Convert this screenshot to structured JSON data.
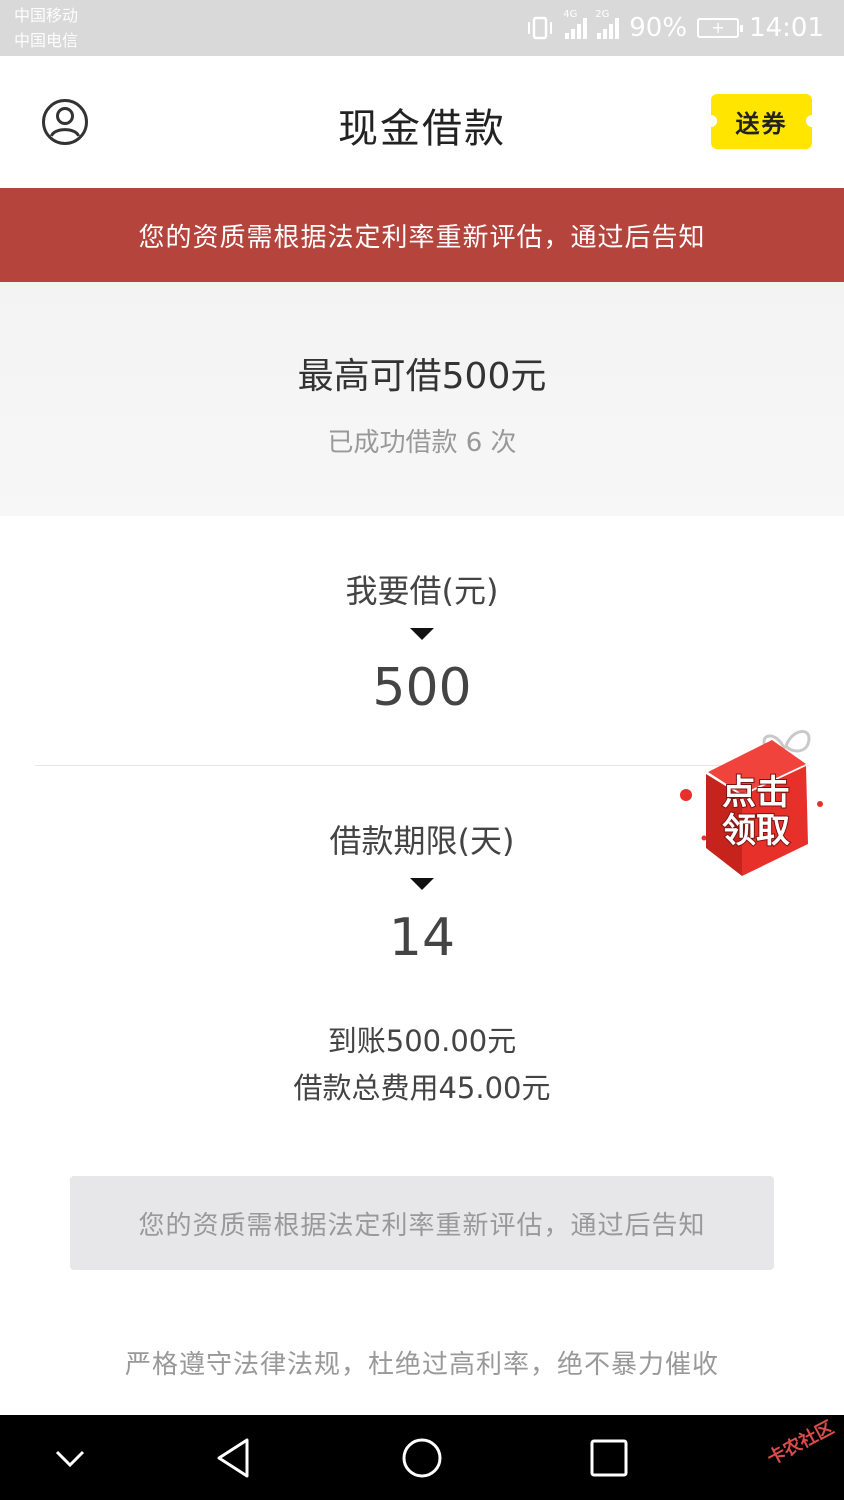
{
  "status_bar": {
    "carrier_1": "中国移动",
    "carrier_2": "中国电信",
    "network_1": "4G",
    "network_2": "2G",
    "battery": "90%",
    "time": "14:01"
  },
  "header": {
    "title": "现金借款",
    "coupon_label": "送券",
    "avatar_icon": "user-circle-icon"
  },
  "banner": {
    "text": "您的资质需根据法定利率重新评估，通过后告知"
  },
  "limit": {
    "title": "最高可借500元",
    "subtitle": "已成功借款 6 次"
  },
  "loan_amount": {
    "label": "我要借(元)",
    "value": "500"
  },
  "loan_term": {
    "label": "借款期限(天)",
    "value": "14"
  },
  "summary": {
    "received": "到账500.00元",
    "total_fee": "借款总费用45.00元"
  },
  "gift": {
    "line1": "点击",
    "line2": "领取"
  },
  "submit": {
    "label": "您的资质需根据法定利率重新评估，通过后告知"
  },
  "footer": {
    "note": "严格遵守法律法规，杜绝过高利率，绝不暴力催收"
  },
  "nav": {
    "watermark": "卡农社区"
  },
  "colors": {
    "banner_bg": "#b5443d",
    "coupon_bg": "#ffe500",
    "gift_red": "#e8302a",
    "button_disabled_bg": "#e7e7ea"
  }
}
